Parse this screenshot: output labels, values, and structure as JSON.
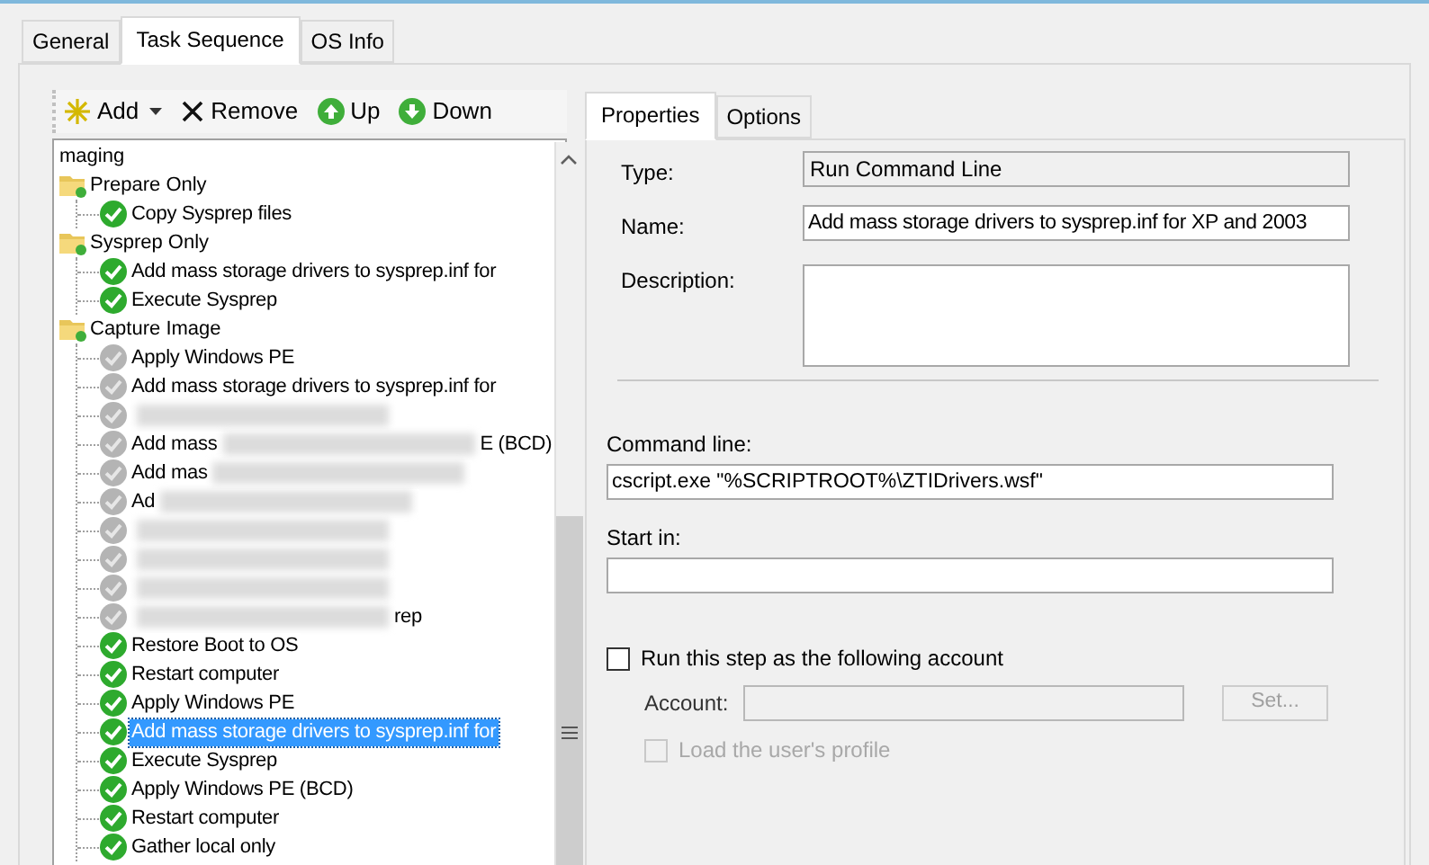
{
  "tabs": [
    {
      "label": "General",
      "selected": false
    },
    {
      "label": "Task Sequence",
      "selected": true
    },
    {
      "label": "OS Info",
      "selected": false
    }
  ],
  "toolbar": [
    {
      "kind": "add",
      "label": "Add"
    },
    {
      "kind": "remove",
      "label": "Remove"
    },
    {
      "kind": "up",
      "label": "Up"
    },
    {
      "kind": "down",
      "label": "Down"
    }
  ],
  "tree": {
    "root": "maging",
    "groups": [
      {
        "label": "Prepare Only",
        "children": [
          {
            "text": "Copy Sysprep files",
            "disabled": false,
            "selected": false
          }
        ]
      },
      {
        "label": "Sysprep Only",
        "children": [
          {
            "text": "Add mass storage drivers to sysprep.inf for",
            "disabled": false,
            "selected": false
          },
          {
            "text": "Execute Sysprep",
            "disabled": false,
            "selected": false
          }
        ]
      },
      {
        "label": "Capture Image",
        "children": [
          {
            "text": "Apply Windows PE",
            "disabled": true,
            "selected": false
          },
          {
            "text": "Add mass storage drivers to sysprep.inf for",
            "disabled": true,
            "selected": false
          },
          {
            "obscured": true,
            "disabled": true,
            "selected": false
          },
          {
            "text": "Add mass",
            "obscured": true,
            "text_after": "E (BCD)",
            "disabled": true,
            "selected": false
          },
          {
            "text": "Add mas",
            "obscured": true,
            "disabled": true,
            "selected": false
          },
          {
            "text": "Ad",
            "obscured": true,
            "disabled": true,
            "selected": false
          },
          {
            "obscured": true,
            "disabled": true,
            "selected": false
          },
          {
            "obscured": true,
            "disabled": true,
            "selected": false
          },
          {
            "obscured": true,
            "disabled": true,
            "selected": false
          },
          {
            "obscured": true,
            "text_after": "rep",
            "disabled": true,
            "selected": false
          },
          {
            "text": "Restore Boot to OS",
            "disabled": false,
            "selected": false
          },
          {
            "text": "Restart computer",
            "disabled": false,
            "selected": false
          },
          {
            "text": "Apply Windows PE",
            "disabled": false,
            "selected": false
          },
          {
            "text": "Add mass storage drivers to sysprep.inf for",
            "disabled": false,
            "selected": true
          },
          {
            "text": "Execute Sysprep",
            "disabled": false,
            "selected": false
          },
          {
            "text": "Apply Windows PE (BCD)",
            "disabled": false,
            "selected": false
          },
          {
            "text": "Restart computer",
            "disabled": false,
            "selected": false
          },
          {
            "text": "Gather local only",
            "disabled": false,
            "selected": false
          }
        ]
      }
    ]
  },
  "detail_tabs": [
    {
      "label": "Properties",
      "selected": true
    },
    {
      "label": "Options",
      "selected": false
    }
  ],
  "properties": {
    "type_label": "Type:",
    "type_value": "Run Command Line",
    "name_label": "Name:",
    "name_value": "Add mass storage drivers to sysprep.inf for XP and 2003",
    "description_label": "Description:",
    "command_line_label": "Command line:",
    "command_line_value": "cscript.exe \"%SCRIPTROOT%\\ZTIDrivers.wsf\"",
    "start_in_label": "Start in:",
    "run_as": {
      "label": "Run this step as the following account",
      "checked": false
    },
    "account_label": "Account:",
    "set_button": "Set...",
    "load_profile": {
      "label": "Load the user's profile",
      "checked": false,
      "disabled": true
    }
  }
}
